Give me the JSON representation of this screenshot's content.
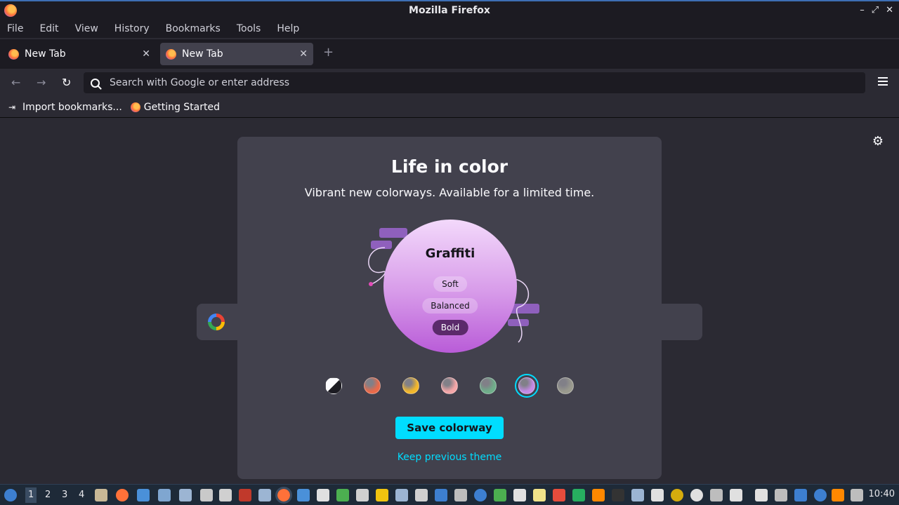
{
  "window": {
    "title": "Mozilla Firefox"
  },
  "menu": [
    "File",
    "Edit",
    "View",
    "History",
    "Bookmarks",
    "Tools",
    "Help"
  ],
  "tabs": [
    {
      "label": "New Tab",
      "active": false
    },
    {
      "label": "New Tab",
      "active": true
    }
  ],
  "urlbar": {
    "placeholder": "Search with Google or enter address"
  },
  "bookmarks": [
    {
      "label": "Import bookmarks...",
      "icon": "import-icon"
    },
    {
      "label": "Getting Started",
      "icon": "firefox-icon"
    }
  ],
  "modal": {
    "title": "Life in color",
    "subtitle": "Vibrant new colorways. Available for a limited time.",
    "colorway_name": "Graffiti",
    "intensities": [
      "Soft",
      "Balanced",
      "Bold"
    ],
    "selected_intensity": "Bold",
    "swatch_colors": [
      "#1c1b22",
      "#e96a4a",
      "#f3b72b",
      "#f4a6a8",
      "#6fae8a",
      "#c58ae6",
      "#9a9a8e"
    ],
    "selected_swatch": 5,
    "save_label": "Save colorway",
    "keep_label": "Keep previous theme"
  },
  "taskbar": {
    "workspaces": [
      "1",
      "2",
      "3",
      "4"
    ],
    "active_workspace": "1",
    "clock": "10:40"
  },
  "colors": {
    "accent": "#00ddff",
    "panel": "#42414d",
    "background": "#2b2a33"
  }
}
